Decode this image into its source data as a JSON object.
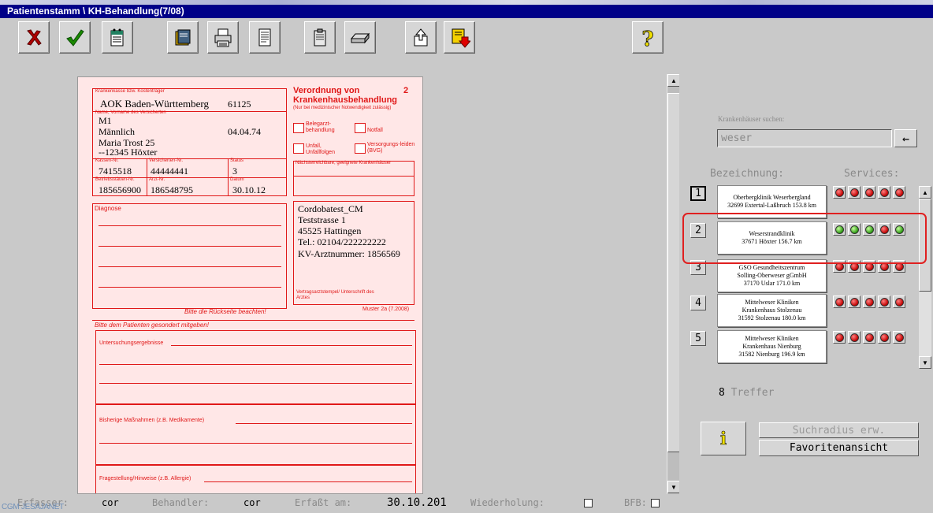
{
  "window": {
    "title": "Patientenstamm \\ KH-Behandlung(7/08)"
  },
  "form": {
    "label_insurer": "Krankenkasse bzw. Kostenträger",
    "insurer": "AOK Baden-Württemberg",
    "insurer_code": "61125",
    "label_name": "Name, Vorname des Versicherten",
    "surname": "M1",
    "firstname": "Männlich",
    "birthdate": "04.04.74",
    "street": "Maria Trost 25",
    "city": "--12345 Höxter",
    "label_kassen_nr": "Kassen-Nr.",
    "label_insured_nr": "Versicherten-Nr.",
    "label_status": "Status",
    "kassen_nr": "7415518",
    "insured_nr": "44444441",
    "status": "3",
    "label_practice_nr": "Betriebsstätten-Nr.",
    "label_doctor_nr": "Arzt-Nr.",
    "label_date": "Datum",
    "practice_nr": "185656900",
    "doctor_nr": "186548795",
    "date": "30.10.12",
    "heading": "Verordnung von Krankenhausbehandlung",
    "copy_number": "2",
    "note": "(Nur bei medizinischer Notwendigkeit zulässig)",
    "cb_elective": "Belegarzt-behandlung",
    "cb_emergency": "Notfall",
    "cb_accident": "Unfall, Unfallfolgen",
    "cb_pension": "Versorgungs-leiden (BVG)",
    "label_nearest": "Nächsterreichbare, geeignete Krankenhäuser",
    "label_diagnosis": "Diagnose",
    "back_note": "Bitte die Rückseite beachten!",
    "practice_name": "Cordobatest_CM",
    "practice_street": "Teststrasse 1",
    "practice_city": "45525 Hattingen",
    "practice_phone": "Tel.: 02104/222222222",
    "practice_doctor_nr": "KV-Arztnummer: 1856569",
    "label_stamp": "Vertragsarztstempel/ Unterschrift des Arztes",
    "model": "Muster 2a (7.2008)",
    "handout": "Bitte dem Patienten gesondert mitgeben!",
    "label_exam": "Untersuchungsergebnisse",
    "label_measures": "Bisherige Maßnahmen (z.B. Medikamente)",
    "label_questions": "Fragestellung/Hinweise (z.B. Allergie)"
  },
  "status": {
    "creator_label": "Erfasser:",
    "creator": "cor",
    "practitioner_label": "Behandler:",
    "practitioner": "cor",
    "captured_label": "Erfaßt am:",
    "captured": "30.10.201",
    "repeat_label": "Wiederholung:",
    "bfb_label": "BFB:"
  },
  "watermark": "CGM JESAJANET",
  "search": {
    "label": "Krankenhäuser suchen:",
    "value": "weser",
    "arrow": "←"
  },
  "list": {
    "col_name": "Bezeichnung:",
    "col_services": "Services:",
    "rows": [
      {
        "num": "1",
        "l1": "Oberbergklinik Weserbergland",
        "l2": "32699 Extertal-Laßbruch 153.8 km",
        "lights": [
          "red",
          "red",
          "red",
          "red",
          "red"
        ]
      },
      {
        "num": "2",
        "l1": "Weserstrandklinik",
        "l2": "37671 Höxter 156.7 km",
        "lights": [
          "green",
          "green",
          "green",
          "red",
          "green"
        ]
      },
      {
        "num": "3",
        "l1": "GSO Gesundheitszentrum",
        "l2": "Solling-Oberweser gGmbH",
        "l3": "37170 Uslar 171.0 km",
        "lights": [
          "red",
          "red",
          "red",
          "red",
          "red"
        ]
      },
      {
        "num": "4",
        "l1": "Mittelweser Kliniken",
        "l2": "Krankenhaus Stolzenau",
        "l3": "31592 Stolzenau 180.0 km",
        "lights": [
          "red",
          "red",
          "red",
          "red",
          "red"
        ]
      },
      {
        "num": "5",
        "l1": "Mittelweser Kliniken",
        "l2": "Krankenhaus Nienburg",
        "l3": "31582 Nienburg 196.9 km",
        "lights": [
          "red",
          "red",
          "red",
          "red",
          "red"
        ]
      }
    ],
    "count": "8",
    "count_label": "Treffer"
  },
  "buttons": {
    "info": "i",
    "expand": "Suchradius erw.",
    "favorites": "Favoritenansicht"
  },
  "colors": {
    "titlebar": "#000088",
    "form_red": "#e01818",
    "form_bg": "#ffe7e7",
    "light_red": "#c00000",
    "light_green": "#2a9a10",
    "highlight": "#e02020"
  }
}
